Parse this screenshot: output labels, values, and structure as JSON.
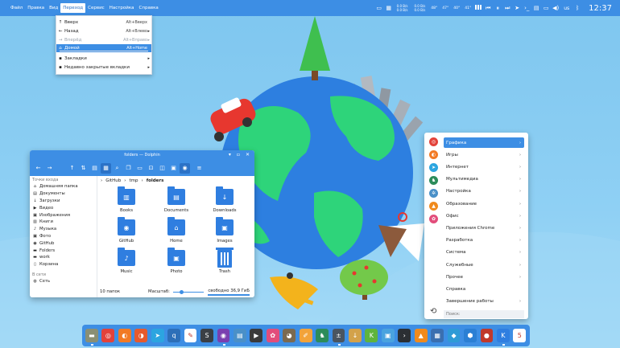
{
  "menubar": [
    "Файл",
    "Правка",
    "Вид",
    "Переход",
    "Сервис",
    "Настройка",
    "Справка"
  ],
  "tray": {
    "net": {
      "up": "0.0 B/s",
      "down": "0.0 B/s",
      "up2": "0.0 B/s",
      "down2": "0.0 B/s"
    },
    "temps": [
      "48°",
      "47°",
      "40°",
      "41°"
    ],
    "lang": "us",
    "clock": "12:37"
  },
  "goto_menu": [
    {
      "icon": "↑",
      "label": "Вверх",
      "shortcut": "Alt+Вверх",
      "arrow": ""
    },
    {
      "icon": "←",
      "label": "Назад",
      "shortcut": "Alt+Влево",
      "arrow": "▸"
    },
    {
      "icon": "→",
      "label": "Вперёд",
      "shortcut": "Alt+Вправо",
      "arrow": "▸"
    },
    {
      "icon": "⌂",
      "label": "Домой",
      "shortcut": "Alt+Home",
      "arrow": ""
    },
    {
      "icon": "▪",
      "label": "Закладки",
      "shortcut": "",
      "arrow": "▸"
    },
    {
      "icon": "▪",
      "label": "Недавно закрытые вкладки",
      "shortcut": "",
      "arrow": "▸"
    }
  ],
  "dolphin": {
    "title": "folders — Dolphin",
    "places_header": "Точки входа",
    "places": [
      {
        "icon": "⌂",
        "label": "Домашняя папка"
      },
      {
        "icon": "▤",
        "label": "Документы"
      },
      {
        "icon": "↓",
        "label": "Загрузки"
      },
      {
        "icon": "▶",
        "label": "Видео"
      },
      {
        "icon": "▣",
        "label": "Изображения"
      },
      {
        "icon": "▥",
        "label": "Книги"
      },
      {
        "icon": "♪",
        "label": "Музыка"
      },
      {
        "icon": "▣",
        "label": "Фото"
      },
      {
        "icon": "◉",
        "label": "GitHub"
      },
      {
        "icon": "▬",
        "label": "Folders"
      },
      {
        "icon": "▬",
        "label": "work"
      },
      {
        "icon": "▯",
        "label": "Корзина"
      }
    ],
    "network_header": "В сети",
    "network": [
      {
        "icon": "◍",
        "label": "Сеть"
      }
    ],
    "breadcrumb": [
      "GitHub",
      "tmp",
      "folders"
    ],
    "files": [
      {
        "label": "Books",
        "glyph": "▥"
      },
      {
        "label": "Documents",
        "glyph": "▤"
      },
      {
        "label": "Downloads",
        "glyph": "↓"
      },
      {
        "label": "GitHub",
        "glyph": "◉"
      },
      {
        "label": "Home",
        "glyph": "⌂"
      },
      {
        "label": "Images",
        "glyph": "▣"
      },
      {
        "label": "Music",
        "glyph": "♪"
      },
      {
        "label": "Photo",
        "glyph": "▣"
      },
      {
        "label": "Trash",
        "glyph": ""
      }
    ],
    "status_count": "10 папок",
    "zoom_label": "Масштаб:",
    "free_space": "свободно 36,9 ГиБ"
  },
  "launcher": {
    "categories": [
      "Графика",
      "Игры",
      "Интернет",
      "Мультимедиа",
      "Настройка",
      "Образование",
      "Офис",
      "Приложения Chrome",
      "Разработка",
      "Система",
      "Служебные",
      "Прочее",
      "Справка",
      "Завершение работы"
    ],
    "arrowless": [
      "Справка"
    ],
    "search_placeholder": "Поиск:"
  },
  "dock_items": [
    {
      "name": "files-icon",
      "color": "#8a8f74",
      "glyph": "▬"
    },
    {
      "name": "chrome-icon",
      "color": "#e3423a",
      "glyph": "◎"
    },
    {
      "name": "firefox-icon",
      "color": "#f27a24",
      "glyph": "◐"
    },
    {
      "name": "firefox-alt-icon",
      "color": "#e65a2d",
      "glyph": "◑"
    },
    {
      "name": "telegram-icon",
      "color": "#2ca5e0",
      "glyph": "➤"
    },
    {
      "name": "qbittorrent-icon",
      "color": "#2d6fb8",
      "glyph": "q"
    },
    {
      "name": "inkscape-icon",
      "color": "#ffffff",
      "glyph": "✎"
    },
    {
      "name": "sublime-icon",
      "color": "#3b3f45",
      "glyph": "S"
    },
    {
      "name": "github-desktop-icon",
      "color": "#7a3fb0",
      "glyph": "◉"
    },
    {
      "name": "okular-icon",
      "color": "#4a90c8",
      "glyph": "▤"
    },
    {
      "name": "kdenlive-icon",
      "color": "#3a3a3a",
      "glyph": "▶"
    },
    {
      "name": "krita-icon",
      "color": "#e24d7b",
      "glyph": "✿"
    },
    {
      "name": "gimp-icon",
      "color": "#7b6a50",
      "glyph": "◕"
    },
    {
      "name": "paint-icon",
      "color": "#f2a33a",
      "glyph": "✐"
    },
    {
      "name": "chess-icon",
      "color": "#2c8c5a",
      "glyph": "♞"
    },
    {
      "name": "calculator-icon",
      "color": "#4a5560",
      "glyph": "±"
    },
    {
      "name": "download-icon",
      "color": "#d3a24a",
      "glyph": "↓"
    },
    {
      "name": "kate-icon",
      "color": "#5fb43d",
      "glyph": "K"
    },
    {
      "name": "screenshot-icon",
      "color": "#4aa3df",
      "glyph": "▣"
    },
    {
      "name": "terminal-icon",
      "color": "#2b2f33",
      "glyph": "›"
    },
    {
      "name": "vlc-icon",
      "color": "#f08a1c",
      "glyph": "▲"
    },
    {
      "name": "system-monitor-icon",
      "color": "#3a6fb0",
      "glyph": "▦"
    },
    {
      "name": "games-icon",
      "color": "#2f9bd6",
      "glyph": "◆"
    },
    {
      "name": "android-icon",
      "color": "#2b7fd4",
      "glyph": "⬢"
    },
    {
      "name": "disk-icon",
      "color": "#c0392b",
      "glyph": "●"
    },
    {
      "name": "discover-icon",
      "color": "#2f7ee0",
      "glyph": "K"
    },
    {
      "name": "calendar-icon",
      "color": "#ffffff",
      "glyph": "5"
    }
  ]
}
